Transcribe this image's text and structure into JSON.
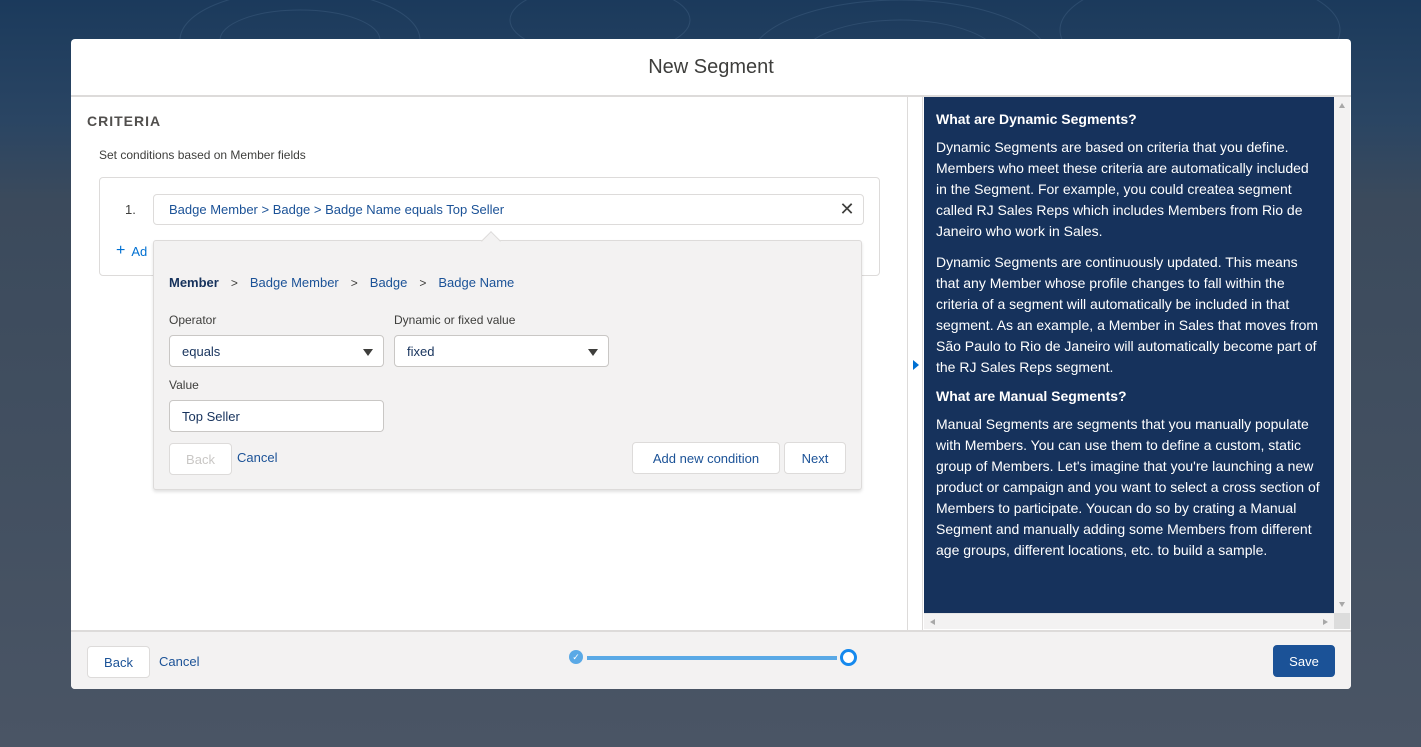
{
  "modal": {
    "title": "New Segment"
  },
  "criteria": {
    "heading": "CRITERIA",
    "subtitle": "Set conditions based on Member fields",
    "condition_number": "1.",
    "condition_text": "Badge Member > Badge > Badge Name equals Top Seller",
    "add_link_label": "Ad"
  },
  "editor": {
    "breadcrumbs": {
      "root": "Member",
      "items": [
        "Badge Member",
        "Badge",
        "Badge Name"
      ],
      "separator": ">"
    },
    "operator": {
      "label": "Operator",
      "value": "equals"
    },
    "dynamic": {
      "label": "Dynamic or fixed value",
      "value": "fixed"
    },
    "value": {
      "label": "Value",
      "value": "Top Seller"
    },
    "back_label": "Back",
    "cancel_label": "Cancel",
    "add_new_label": "Add new condition",
    "next_label": "Next"
  },
  "help": {
    "h1": "What are Dynamic Segments?",
    "p1": "Dynamic Segments are based on criteria that you define. Members who meet these criteria are automatically included in the Segment. For example, you could createa segment called RJ Sales Reps which includes Members from Rio de Janeiro who work in Sales.",
    "p2": "Dynamic Segments are continuously updated. This means that any Member whose profile changes to fall within the criteria of a segment will automatically be included in that segment. As an example, a Member in Sales that moves from São Paulo to Rio de Janeiro will automatically become part of the RJ Sales Reps segment.",
    "h2": "What are Manual Segments?",
    "p3": "Manual Segments are segments that you manually populate with Members. You can use them to define a custom, static group of Members. Let's imagine that you're launching a new product or campaign and you want to select a cross section of Members to participate. Youcan do so by crating a Manual Segment and manually adding some Members from different age groups, different locations, etc. to build a sample."
  },
  "footer": {
    "back_label": "Back",
    "cancel_label": "Cancel",
    "save_label": "Save",
    "progress": {
      "steps": 2,
      "current_step": 2,
      "completed_steps": 1
    }
  },
  "colors": {
    "brand": "#1b5297",
    "help_bg": "#16325c",
    "progress": "#1589ee"
  },
  "icons": {
    "close": "close-icon",
    "add": "add-icon",
    "caret": "chevron-down-icon",
    "check": "check-icon"
  }
}
